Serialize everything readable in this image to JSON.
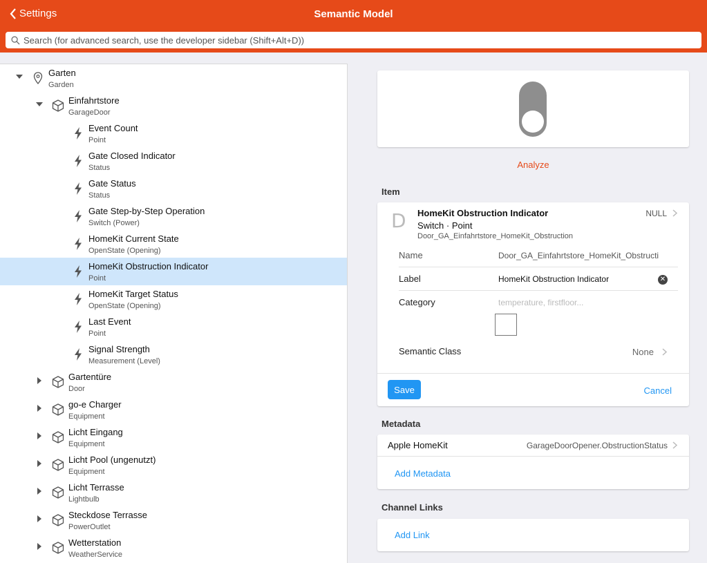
{
  "header": {
    "back_label": "Settings",
    "title": "Semantic Model",
    "search_placeholder": "Search (for advanced search, use the developer sidebar (Shift+Alt+D))"
  },
  "tree": {
    "root": {
      "label": "Garten",
      "sub": "Garden",
      "icon": "location-pin-icon",
      "expanded": true
    },
    "equipment": {
      "label": "Einfahrtstore",
      "sub": "GarageDoor",
      "icon": "cube-icon",
      "expanded": true
    },
    "points": [
      {
        "label": "Event Count",
        "sub": "Point"
      },
      {
        "label": "Gate Closed Indicator",
        "sub": "Status"
      },
      {
        "label": "Gate Status",
        "sub": "Status"
      },
      {
        "label": "Gate Step-by-Step Operation",
        "sub": "Switch (Power)"
      },
      {
        "label": "HomeKit Current State",
        "sub": "OpenState (Opening)"
      },
      {
        "label": "HomeKit Obstruction Indicator",
        "sub": "Point",
        "selected": true
      },
      {
        "label": "HomeKit Target Status",
        "sub": "OpenState (Opening)"
      },
      {
        "label": "Last Event",
        "sub": "Point"
      },
      {
        "label": "Signal Strength",
        "sub": "Measurement (Level)"
      }
    ],
    "siblings": [
      {
        "label": "Gartentüre",
        "sub": "Door"
      },
      {
        "label": "go-e Charger",
        "sub": "Equipment"
      },
      {
        "label": "Licht Eingang",
        "sub": "Equipment"
      },
      {
        "label": "Licht Pool (ungenutzt)",
        "sub": "Equipment"
      },
      {
        "label": "Licht Terrasse",
        "sub": "Lightbulb"
      },
      {
        "label": "Steckdose Terrasse",
        "sub": "PowerOutlet"
      },
      {
        "label": "Wetterstation",
        "sub": "WeatherService"
      }
    ]
  },
  "detail": {
    "toggle_state": "off",
    "analyze_label": "Analyze",
    "item_section": "Item",
    "item": {
      "letter": "D",
      "title": "HomeKit Obstruction Indicator",
      "type": "Switch · Point",
      "name": "Door_GA_Einfahrtstore_HomeKit_Obstruction",
      "state": "NULL"
    },
    "form": {
      "name_label": "Name",
      "name_value": "Door_GA_Einfahrtstore_HomeKit_Obstructi",
      "label_label": "Label",
      "label_value": "HomeKit Obstruction Indicator",
      "category_label": "Category",
      "category_placeholder": "temperature, firstfloor...",
      "semantic_label": "Semantic Class",
      "semantic_value": "None"
    },
    "save_label": "Save",
    "cancel_label": "Cancel",
    "metadata_section": "Metadata",
    "metadata": [
      {
        "label": "Apple HomeKit",
        "value": "GarageDoorOpener.ObstructionStatus"
      }
    ],
    "add_metadata_label": "Add Metadata",
    "channel_section": "Channel Links",
    "add_link_label": "Add Link"
  },
  "colors": {
    "accent": "#e64a19",
    "primary_button": "#2196f3",
    "selected_row": "#cfe6fb"
  }
}
